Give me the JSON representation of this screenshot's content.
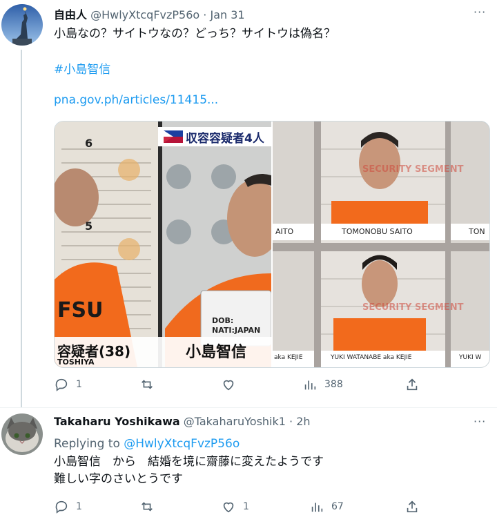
{
  "tweet1": {
    "display_name": "自由人",
    "handle": "@HwlyXtcqFvzP56o",
    "dot": "·",
    "date": "Jan 31",
    "more": "···",
    "text_line1": "小島なの？サイトウなの？どっち？サイトウは偽名？",
    "hashtag": "#小島智信",
    "url": "pna.gov.ph/articles/11415...",
    "media": {
      "left": {
        "banner": "収容容疑者4人",
        "ruler_top": "6",
        "ruler_mid": "5",
        "shirt": "FSU",
        "caption_left": "容疑者(38)",
        "caption_left_sub": "TOSHIYA",
        "caption_right": "小島智信",
        "placard_dob": "DOB:",
        "placard_nat": "NATI:JAPAN"
      },
      "right": {
        "top_name": "TOMONOBU SAITO",
        "top_name_left": "AITO",
        "top_name_right": "TON",
        "bottom_name": "YUKI WATANABE aka KEJIE",
        "bottom_name_left": "aka KEJIE",
        "bottom_name_right": "YUKI W",
        "wall_text": "SECURITY SEGMENT"
      }
    },
    "actions": {
      "reply_count": "1",
      "retweet_count": "",
      "like_count": "",
      "views_count": "388"
    }
  },
  "tweet2": {
    "display_name": "Takaharu Yoshikawa",
    "handle": "@TakaharuYoshik1",
    "dot": "·",
    "date": "2h",
    "more": "···",
    "replying_prefix": "Replying to",
    "replying_handle": "@HwlyXtcqFvzP56o",
    "text_line1": "小島智信　から　結婚を境に齋藤に変えたようです",
    "text_line2": "難しい字のさいとうです",
    "actions": {
      "reply_count": "1",
      "retweet_count": "",
      "like_count": "1",
      "views_count": "67"
    }
  },
  "colors": {
    "accent": "#1d9bf0",
    "text": "#0f1419",
    "muted": "#536471",
    "orange": "#f06a1e"
  }
}
